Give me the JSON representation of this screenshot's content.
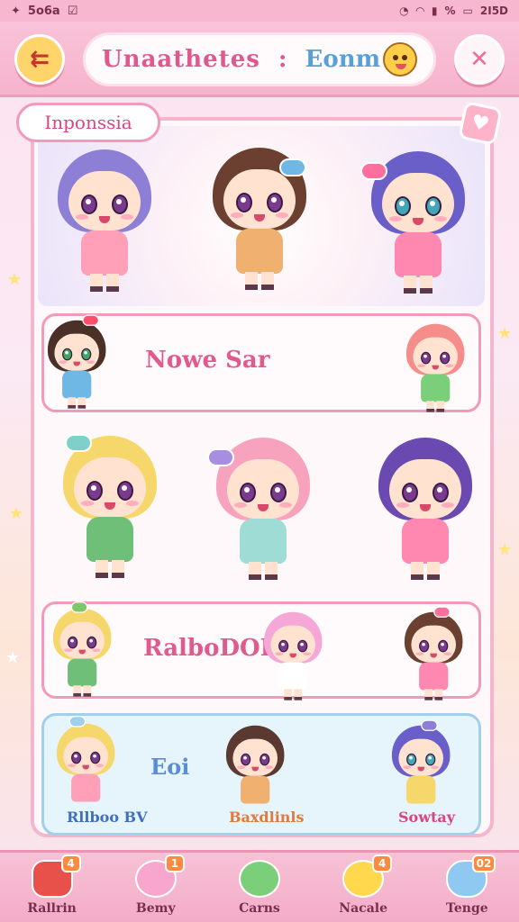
{
  "status_bar": {
    "time": "5o6a",
    "battery": "%",
    "extra": "2I5D"
  },
  "header": {
    "title": "Unaathetes",
    "separator": ":",
    "subtitle": "Eonm"
  },
  "section": {
    "tab_label": "Inponssia"
  },
  "cards": [
    {
      "label": "Nowe Sar"
    },
    {
      "label": "RalboDOI!"
    },
    {
      "label": "Eoi"
    }
  ],
  "character_names": [
    "Rllboo BV",
    "Baxdlinls",
    "Sowtay"
  ],
  "bottom_nav": [
    {
      "label": "Rallrin",
      "badge": "4",
      "icon": "house-icon"
    },
    {
      "label": "Bemy",
      "badge": "1",
      "icon": "blob-icon"
    },
    {
      "label": "Carns",
      "badge": "",
      "icon": "slime-icon"
    },
    {
      "label": "Nacale",
      "badge": "4",
      "icon": "sun-face-icon"
    },
    {
      "label": "Tenge",
      "badge": "02",
      "icon": "cloud-face-icon"
    }
  ],
  "colors": {
    "accent": "#e15a8e",
    "header": "#f6b3cc",
    "blue_text": "#5a8ed3"
  }
}
